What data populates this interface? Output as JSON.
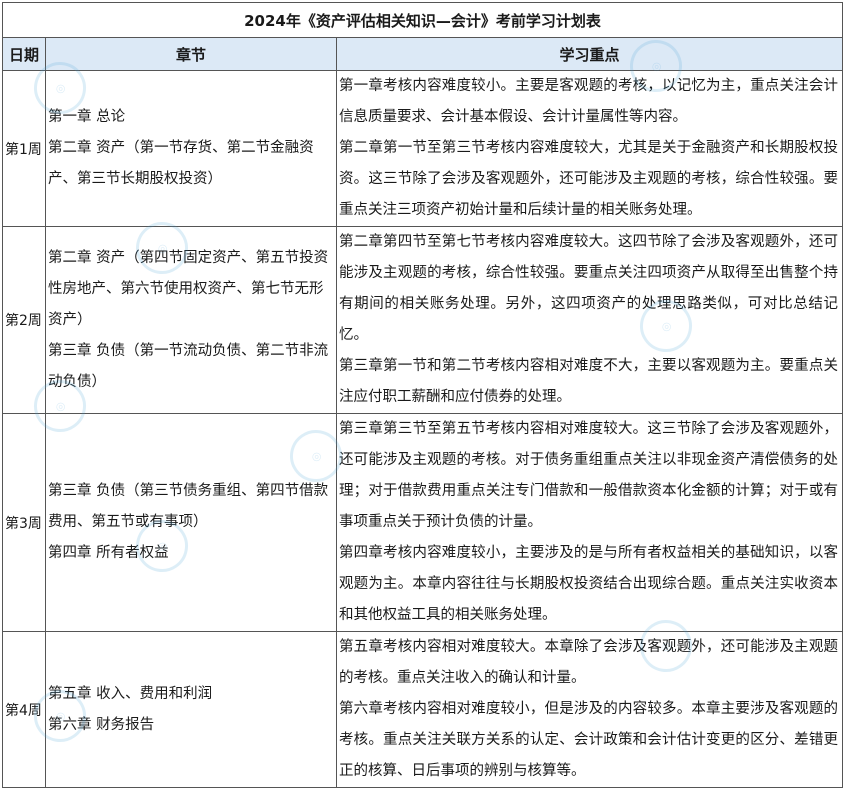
{
  "title": "2024年《资产评估相关知识—会计》考前学习计划表",
  "headers": {
    "date": "日期",
    "chapter": "章节",
    "focus": "学习重点"
  },
  "rows": [
    {
      "week": "第1周",
      "chapters": [
        "第一章  总论",
        "第二章  资产（第一节存货、第二节金融资产、第三节长期股权投资）"
      ],
      "focus": [
        "第一章考核内容难度较小。主要是客观题的考核，以记忆为主，重点关注会计信息质量要求、会计基本假设、会计计量属性等内容。",
        "第二章第一节至第三节考核内容难度较大，尤其是关于金融资产和长期股权投资。这三节除了会涉及客观题外，还可能涉及主观题的考核，综合性较强。要重点关注三项资产初始计量和后续计量的相关账务处理。"
      ]
    },
    {
      "week": "第2周",
      "chapters": [
        "第二章  资产（第四节固定资产、第五节投资性房地产、第六节使用权资产、第七节无形资产）",
        "第三章  负债（第一节流动负债、第二节非流动负债）"
      ],
      "focus": [
        "第二章第四节至第七节考核内容难度较大。这四节除了会涉及客观题外，还可能涉及主观题的考核，综合性较强。要重点关注四项资产从取得至出售整个持有期间的相关账务处理。另外，这四项资产的处理思路类似，可对比总结记忆。",
        "第三章第一节和第二节考核内容相对难度不大，主要以客观题为主。要重点关注应付职工薪酬和应付债券的处理。"
      ]
    },
    {
      "week": "第3周",
      "chapters": [
        "第三章  负债（第三节债务重组、第四节借款费用、第五节或有事项）",
        "第四章  所有者权益"
      ],
      "focus": [
        "第三章第三节至第五节考核内容相对难度较大。这三节除了会涉及客观题外，还可能涉及主观题的考核。对于债务重组重点关注以非现金资产清偿债务的处理；对于借款费用重点关注专门借款和一般借款资本化金额的计算；对于或有事项重点关于预计负债的计量。",
        "第四章考核内容难度较小，主要涉及的是与所有者权益相关的基础知识，以客观题为主。本章内容往往与长期股权投资结合出现综合题。重点关注实收资本和其他权益工具的相关账务处理。"
      ]
    },
    {
      "week": "第4周",
      "chapters": [
        "第五章  收入、费用和利润",
        "第六章  财务报告"
      ],
      "focus": [
        "第五章考核内容相对难度较大。本章除了会涉及客观题外，还可能涉及主观题的考核。重点关注收入的确认和计量。",
        "第六章考核内容相对难度较小，但是涉及的内容较多。本章主要涉及客观题的考核。重点关注关联方关系的认定、会计政策和会计估计变更的区分、差错更正的核算、日后事项的辨别与核算等。"
      ]
    }
  ]
}
